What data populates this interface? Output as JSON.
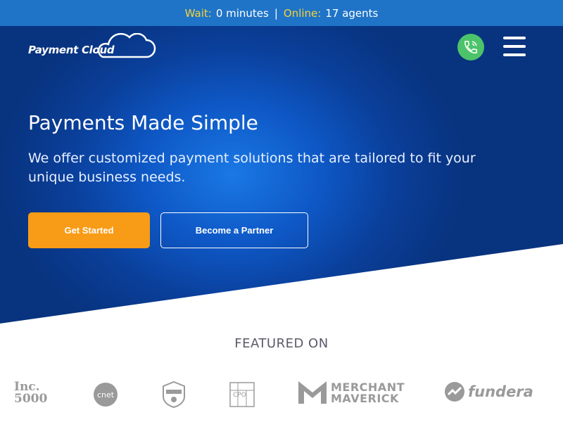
{
  "topbar": {
    "wait_label": "Wait:",
    "wait_value": "0 minutes",
    "separator": "|",
    "online_label": "Online:",
    "online_value": "17 agents"
  },
  "header": {
    "logo_word1": "Payment",
    "logo_word2": "Cloud",
    "phone_icon": "phone-icon",
    "menu_icon": "hamburger-menu-icon"
  },
  "hero": {
    "title": "Payments Made Simple",
    "subtitle": "We offer customized payment solutions that are tailored to fit your unique business needs.",
    "primary_button": "Get Started",
    "secondary_button": "Become a Partner"
  },
  "featured": {
    "heading": "FEATURED ON",
    "logos": {
      "inc_line1": "Inc.",
      "inc_line2": "5000",
      "cnet": "cnet",
      "badge": "badge-icon",
      "cpo": "CPO",
      "merchant_line1": "MERCHANT",
      "merchant_line2": "MAVERICK",
      "fundera": "fundera"
    }
  },
  "colors": {
    "topbar_bg": "#1f74c8",
    "topbar_label": "#f5d23a",
    "hero_blue": "#0e58c6",
    "primary_button": "#f89b16",
    "phone_button": "#4cc36a",
    "logo_gray": "#9a9a9a"
  }
}
